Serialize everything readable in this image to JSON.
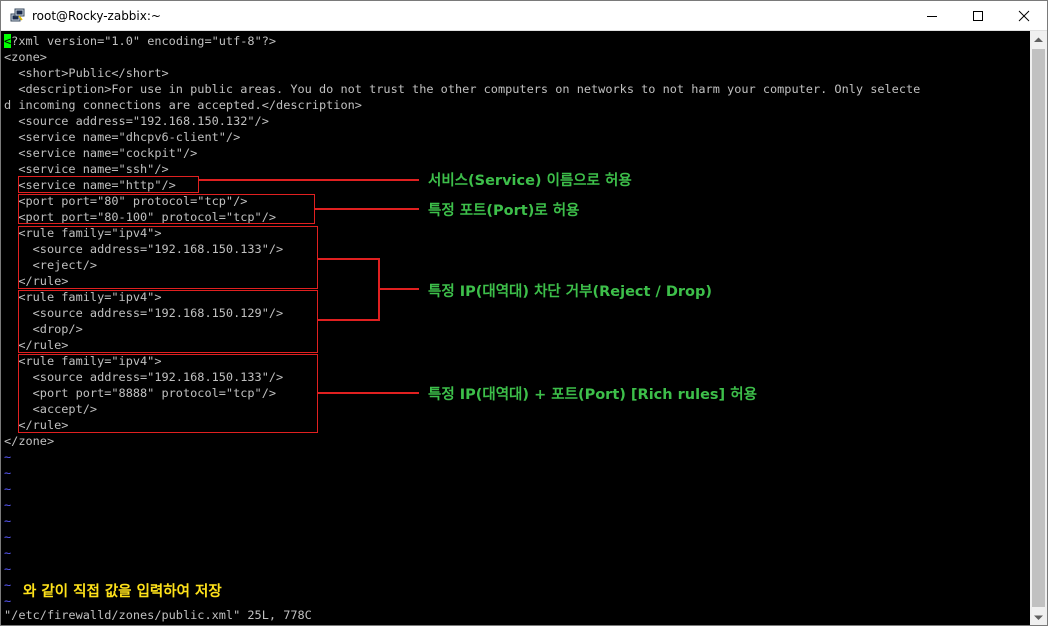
{
  "window": {
    "title": "root@Rocky-zabbix:~",
    "controls": [
      "minimize",
      "maximize",
      "close"
    ]
  },
  "terminal": {
    "lines": [
      "<?xml version=\"1.0\" encoding=\"utf-8\"?>",
      "<zone>",
      "  <short>Public</short>",
      "  <description>For use in public areas. You do not trust the other computers on networks to not harm your computer. Only selecte",
      "d incoming connections are accepted.</description>",
      "  <source address=\"192.168.150.132\"/>",
      "  <service name=\"dhcpv6-client\"/>",
      "  <service name=\"cockpit\"/>",
      "  <service name=\"ssh\"/>",
      "  <service name=\"http\"/>",
      "  <port port=\"80\" protocol=\"tcp\"/>",
      "  <port port=\"80-100\" protocol=\"tcp\"/>",
      "  <rule family=\"ipv4\">",
      "    <source address=\"192.168.150.133\"/>",
      "    <reject/>",
      "  </rule>",
      "  <rule family=\"ipv4\">",
      "    <source address=\"192.168.150.129\"/>",
      "    <drop/>",
      "  </rule>",
      "  <rule family=\"ipv4\">",
      "    <source address=\"192.168.150.133\"/>",
      "    <port port=\"8888\" protocol=\"tcp\"/>",
      "    <accept/>",
      "  </rule>",
      "</zone>"
    ],
    "empty_line_marker": "~",
    "status_line": "\"/etc/firewalld/zones/public.xml\" 25L, 778C"
  },
  "annotations": {
    "service": "서비스(Service) 이름으로 허용",
    "port": "특정 포트(Port)로 허용",
    "reject_drop": "특정 IP(대역대) 차단 거부(Reject / Drop)",
    "rich_rules": "특정 IP(대역대) + 포트(Port) [Rich rules] 허용",
    "bottom_note": "와 같이 직접 값을 입력하여 저장"
  },
  "colors": {
    "terminal_bg": "#000000",
    "terminal_text": "#c0c0c0",
    "tilde": "#5b5bff",
    "cursor": "#00ff00",
    "highlight_box": "#e02020",
    "annotation_text": "#3dbf4a",
    "note_text": "#ffe21a"
  }
}
